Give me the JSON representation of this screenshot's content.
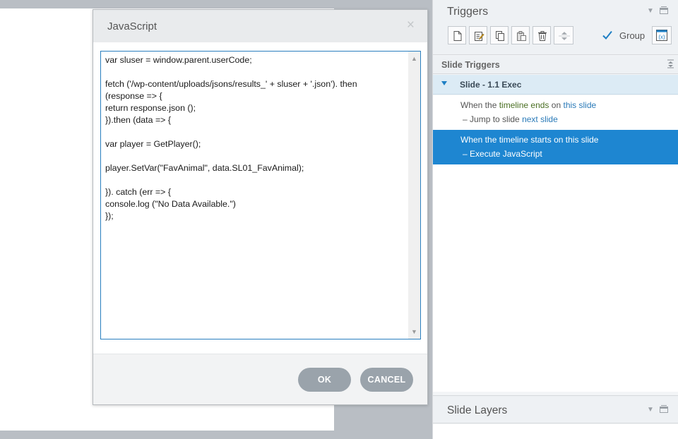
{
  "dialog": {
    "title": "JavaScript",
    "close": "×",
    "code": "var sluser = window.parent.userCode;\n\nfetch ('/wp-content/uploads/jsons/results_' + sluser + '.json'). then\n(response => {\nreturn response.json ();\n}).then (data => {\n\nvar player = GetPlayer();\n\nplayer.SetVar(\"FavAnimal\", data.SL01_FavAnimal);\n\n}). catch (err => {\nconsole.log (\"No Data Available.\")\n});",
    "ok_label": "OK",
    "cancel_label": "CANCEL"
  },
  "triggers_panel": {
    "title": "Triggers",
    "group_label": "Group",
    "group_checked": true,
    "toolbar_icons": [
      "new-trigger-icon",
      "edit-trigger-icon",
      "copy-icon",
      "paste-icon",
      "delete-icon",
      "move-up-down-icon",
      "variables-icon"
    ]
  },
  "slide_triggers": {
    "title": "Slide Triggers",
    "slide_label": "Slide - 1.1 Exec",
    "triggers": [
      {
        "when_prefix": "When the",
        "event": "timeline ends",
        "on_text": "on",
        "object": "this slide",
        "action_prefix": "Jump to slide",
        "action_target": "next slide",
        "selected": false
      },
      {
        "when_prefix": "When the",
        "event": "timeline starts",
        "on_text": "on",
        "object": "this slide",
        "action_prefix": "Execute JavaScript",
        "action_target": "",
        "selected": true
      }
    ]
  },
  "slide_layers": {
    "title": "Slide Layers"
  },
  "colors": {
    "accent": "#1e86d1",
    "button_gray": "#9aa3ab",
    "code_border": "#2a7fbf"
  }
}
